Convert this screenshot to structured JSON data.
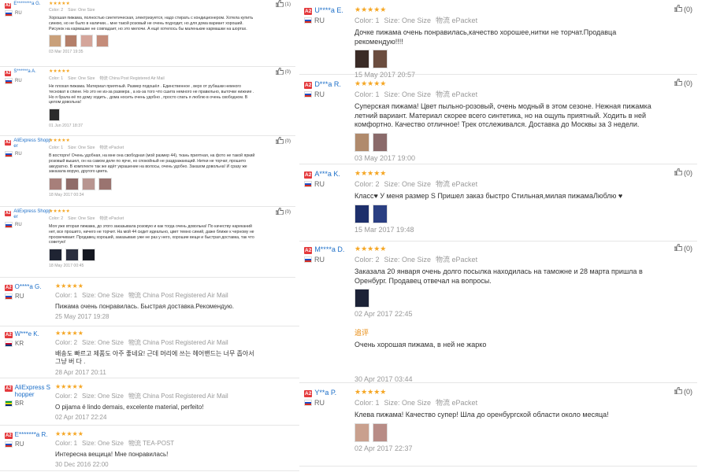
{
  "reviews_left": [
    {
      "user": "E********a G.",
      "country": "RU",
      "flag_colors": [
        "#ffffff",
        "#1e4fc7",
        "#d52b1e"
      ],
      "stars": "★★★★★",
      "color": "Color: 2",
      "size": "Size: One Size",
      "shipping": "",
      "text": "Хорошая пижама, полностью синтетическая, электризуется, надо стирать с кондиционером. Хотела купить синюю, но не было в наличии... мне такой розовый не очень подходит, но для дома вариант хороший. Рисунок на кармашке не совпадает, но это мелочи. А ещё хотелось бы маленькие кармашки на шортах.",
      "date": "03 Mar 2017 19:35",
      "helpful": "(1)",
      "thumb_colors": [
        "#c9a07a",
        "#b47f6a",
        "#d4a59a",
        "#c48c7a"
      ]
    },
    {
      "user": "S******a A.",
      "country": "RU",
      "flag_colors": [
        "#ffffff",
        "#1e4fc7",
        "#d52b1e"
      ],
      "stars": "★★★★★",
      "color": "Color: 1",
      "size": "Size: One Size",
      "shipping": "物流 China Post Registered Air Mail",
      "text": "Не плохая пижама. Материал приятный. Размер подошёл . Единственное , верх от рубашки немного тесноват в спине. Но это не из-за размера , а из-за того что сшита немного не правильно, выточки нижние . Но я брала её по дому ходить , дома носить очень удобно , просто спать я люблю в очень свободном. В целом довольна!",
      "date": "01 Jun 2017 18:37",
      "helpful": "(0)",
      "thumb_colors": [
        "#2b2b2b"
      ]
    },
    {
      "user": "AliExpress Shopper",
      "country": "RU",
      "flag_colors": [
        "#ffffff",
        "#1e4fc7",
        "#d52b1e"
      ],
      "stars": "★★★★★",
      "color": "Color: 1",
      "size": "Size: One Size",
      "shipping": "物流 ePacket",
      "text": "В восторге! Очень удобная, на мне она свободная (мой размер 44), ткань приятная, на фото не такой яркий розовый вышел, он на самом деле по ярче, но спокойный не раздражающий. Нитки не торчат, прошито аккуратно. В комплекте так же идёт украшение на волосы, очень удобно. Заказом довольна! И сразу же заказала ворую, другого цвета.",
      "date": "18 May 2017 00:34",
      "helpful": "(0)",
      "thumb_colors": [
        "#a77f7a",
        "#8f6c69",
        "#b89590",
        "#9a7470"
      ]
    },
    {
      "user": "AliExpress Shopper",
      "country": "RU",
      "flag_colors": [
        "#ffffff",
        "#1e4fc7",
        "#d52b1e"
      ],
      "stars": "★★★★★",
      "color": "Color: 2",
      "size": "Size: One Size",
      "shipping": "物流 ePacket",
      "text": "Моя уже вторая пижама, до этого заказывала розовую и как тогда очень довольна! По качеству нареканий нет, все прошито, ничего не торчит. На мой 44 сидит идеально, цвет темно синий, даже ближе к черному не просвечивает. Продавец хороший, заказываю уже не раз у него, хорошие вещи и быстрая доставка, так что советую!",
      "date": "18 May 2017 00:45",
      "helpful": "(0)",
      "thumb_colors": [
        "#1f2433",
        "#2b2f3f",
        "#151821"
      ]
    },
    {
      "user": "O****a G.",
      "country": "RU",
      "flag_colors": [
        "#ffffff",
        "#1e4fc7",
        "#d52b1e"
      ],
      "stars": "★★★★★",
      "color": "Color: 1",
      "size": "Size: One Size",
      "shipping": "物流 China Post Registered Air Mail",
      "text": "Пижама очень понравилась. Быстрая доставка.Рекомендую.",
      "date": "25 May 2017 19:28",
      "helpful": "",
      "thumb_colors": []
    },
    {
      "user": "W***e K.",
      "country": "KR",
      "flag_colors": [
        "#ffffff",
        "#c60c30",
        "#003478"
      ],
      "stars": "★★★★★",
      "color": "Color: 2",
      "size": "Size: One Size",
      "shipping": "物流 China Post Registered Air Mail",
      "text": "배송도 빠르고 제품도 아주 좋네요! 근데 머리에 쓰는 헤어밴드는 너무 좁아서 그냥 버 다 .",
      "date": "28 Apr 2017 20:11",
      "helpful": "",
      "thumb_colors": []
    },
    {
      "user": "AliExpress Shopper",
      "country": "BR",
      "flag_colors": [
        "#009c3b",
        "#ffdf00",
        "#002776"
      ],
      "stars": "★★★★★",
      "color": "Color: 2",
      "size": "Size: One Size",
      "shipping": "物流 China Post Registered Air Mail",
      "text": "O pijama é lindo demais, excelente material, perfeito!",
      "date": "02 Apr 2017 22:24",
      "helpful": "",
      "thumb_colors": []
    },
    {
      "user": "E*******a R.",
      "country": "RU",
      "flag_colors": [
        "#ffffff",
        "#1e4fc7",
        "#d52b1e"
      ],
      "stars": "★★★★★",
      "color": "Color: 1",
      "size": "Size: One Size",
      "shipping": "物流 TEA-POST",
      "text": "Интересна вещица! Мне понравилась!",
      "date": "30 Dec 2016 22:00",
      "helpful": "",
      "thumb_colors": []
    }
  ],
  "reviews_right": [
    {
      "user": "U****a E.",
      "country": "RU",
      "flag_colors": [
        "#ffffff",
        "#1e4fc7",
        "#d52b1e"
      ],
      "stars": "★★★★★",
      "color": "Color: 1",
      "size": "Size: One Size",
      "shipping": "物流 ePacket",
      "text": "Дочке пижама очень понравилась,качество хорошее,нитки не торчат.Продавца рекомендую!!!!",
      "date": "15 May 2017 20:57",
      "helpful": "(0)",
      "thumb_colors": [
        "#3a2b26",
        "#6b4d3f"
      ]
    },
    {
      "user": "D***a R.",
      "country": "RU",
      "flag_colors": [
        "#ffffff",
        "#1e4fc7",
        "#d52b1e"
      ],
      "stars": "★★★★★",
      "color": "Color: 1",
      "size": "Size: One Size",
      "shipping": "物流 ePacket",
      "text": "Суперская пижама! Цвет пыльно-розовый, очень модный в этом сезоне. Нежная пижамка летний вариант. Материал скорее всего синтетика, но на ощупь приятный. Ходить в ней комфортно. Качество отличное! Трек отслеживался. Доставка до Москвы за 3 недели.",
      "date": "03 May 2017 19:00",
      "helpful": "(0)",
      "thumb_colors": [
        "#b08a6c",
        "#8a6a6a"
      ]
    },
    {
      "user": "A***a K.",
      "country": "RU",
      "flag_colors": [
        "#ffffff",
        "#1e4fc7",
        "#d52b1e"
      ],
      "stars": "★★★★★",
      "color": "Color: 2",
      "size": "Size: One Size",
      "shipping": "物流 ePacket",
      "text": "Класс♥ У меня размер S Пришел заказ быстро Стильная,милая пижамаЛюблю ♥",
      "date": "15 Mar 2017 19:48",
      "helpful": "(0)",
      "thumb_colors": [
        "#1d2f6b",
        "#2a3f82"
      ]
    },
    {
      "user": "M****a D.",
      "country": "RU",
      "flag_colors": [
        "#ffffff",
        "#1e4fc7",
        "#d52b1e"
      ],
      "stars": "★★★★★",
      "color": "Color: 2",
      "size": "Size: One Size",
      "shipping": "物流 ePacket",
      "text": "Заказала 20 января очень долго посылка находилась на таможне и 28 марта пришла в Оренбург. Продавец отвечал на вопросы.",
      "date": "02 Apr 2017 22:45",
      "helpful": "(0)",
      "thumb_colors": [
        "#1c2236"
      ],
      "followup_label": "追评",
      "followup_text": "Очень хорошая пижама, в ней не жарко",
      "followup_date": "30 Apr 2017 03:44"
    },
    {
      "user": "Y**a P.",
      "country": "RU",
      "flag_colors": [
        "#ffffff",
        "#1e4fc7",
        "#d52b1e"
      ],
      "stars": "★★★★★",
      "color": "Color: 1",
      "size": "Size: One Size",
      "shipping": "物流 ePacket",
      "text": "Клева пижама! Качество супер! Шла до оренбургской области около месяца!",
      "date": "02 Apr 2017 22:37",
      "helpful": "(0)",
      "thumb_colors": [
        "#c9a08e",
        "#b88c86"
      ]
    }
  ],
  "badge_text": "A2"
}
